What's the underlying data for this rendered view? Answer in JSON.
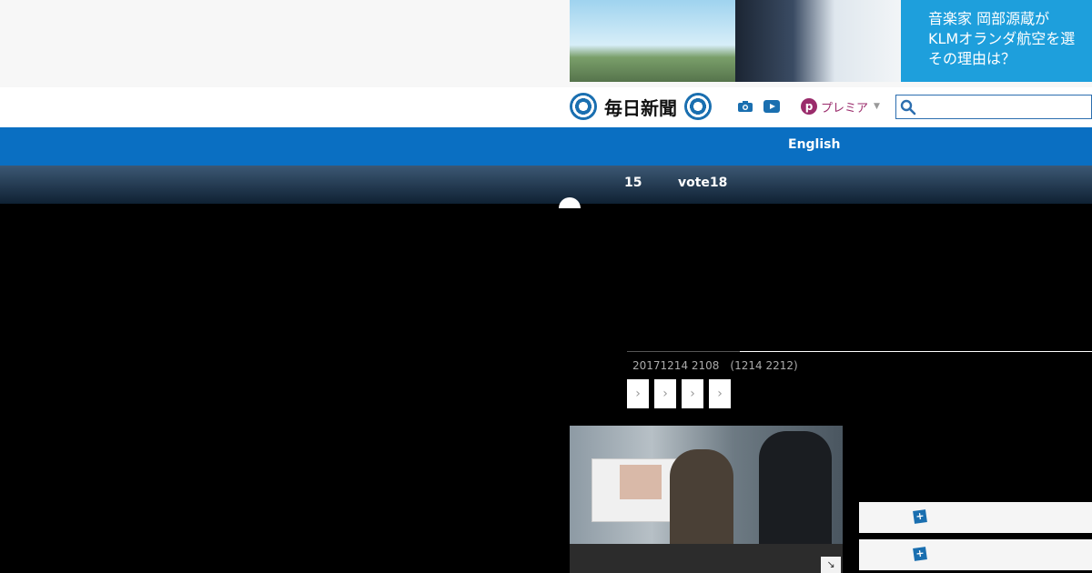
{
  "ad": {
    "text_lines": [
      "音楽家 岡部源蔵が",
      "KLMオランダ航空を選",
      "その理由は？"
    ]
  },
  "header": {
    "brand": "毎日新聞",
    "premium_label": "プレミア"
  },
  "nav": {
    "english": "English",
    "sub_items": [
      "15",
      "vote18"
    ]
  },
  "article": {
    "timestamp": "20171214 2108　(1214 2212)",
    "share_buttons": [
      "›",
      "›",
      "›",
      "›"
    ],
    "photo_expand_glyph": "↘"
  },
  "colors": {
    "nav_blue": "#0a6fc2",
    "nav_dark": "#1a3047",
    "brand_blue": "#1a6fb0",
    "premium": "#9a2b6b",
    "ad_blue": "#1e9fdc"
  },
  "icons": [
    "camera-icon",
    "video-icon",
    "search-icon",
    "premium-p-icon",
    "plus-icon"
  ]
}
